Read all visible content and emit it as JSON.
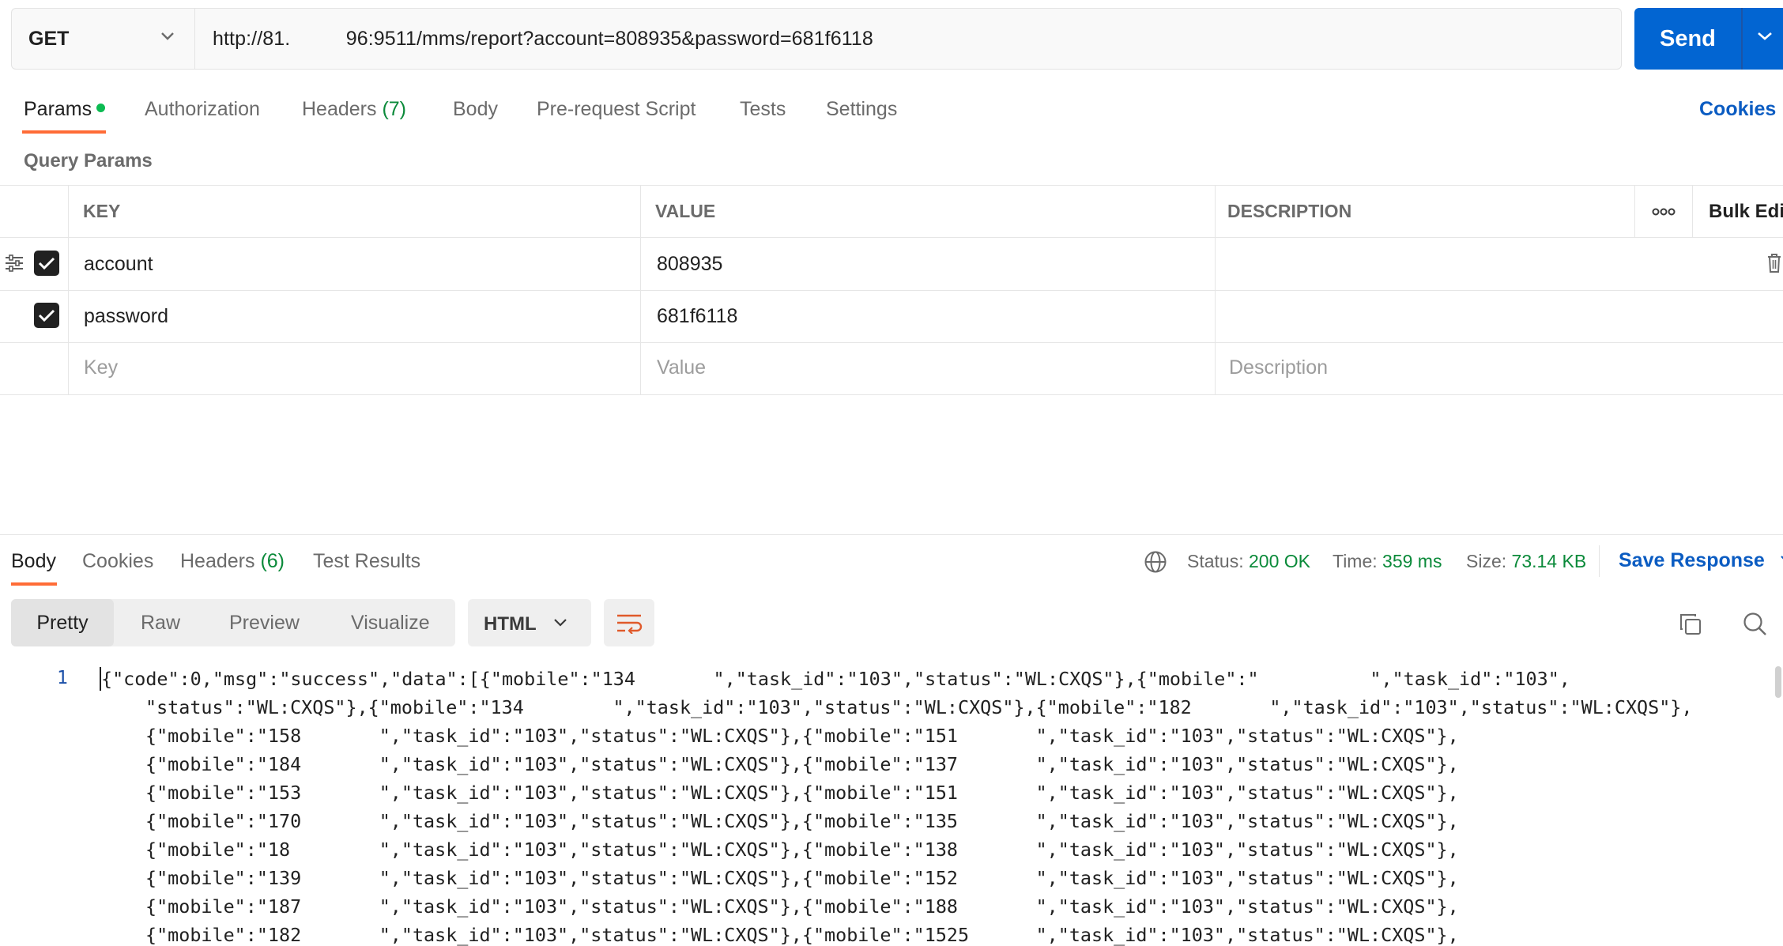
{
  "request": {
    "method": "GET",
    "url": "http://81.          96:9511/mms/report?account=808935&password=681f6118",
    "send_label": "Send"
  },
  "request_tabs": {
    "params": "Params",
    "authorization": "Authorization",
    "headers": "Headers",
    "headers_count": "(7)",
    "body": "Body",
    "pre_request": "Pre-request Script",
    "tests": "Tests",
    "settings": "Settings",
    "cookies": "Cookies"
  },
  "params": {
    "section_title": "Query Params",
    "columns": {
      "key": "KEY",
      "value": "VALUE",
      "description": "DESCRIPTION",
      "bulk_edit": "Bulk Edi"
    },
    "rows": [
      {
        "key": "account",
        "value": "808935",
        "checked": true
      },
      {
        "key": "password",
        "value": "681f6118",
        "checked": true
      }
    ],
    "empty_row": {
      "key": "Key",
      "value": "Value",
      "description": "Description"
    }
  },
  "response_tabs": {
    "body": "Body",
    "cookies": "Cookies",
    "headers": "Headers",
    "headers_count": "(6)",
    "test_results": "Test Results"
  },
  "response_meta": {
    "status_label": "Status:",
    "status_value": "200 OK",
    "time_label": "Time:",
    "time_value": "359 ms",
    "size_label": "Size:",
    "size_value": "73.14 KB",
    "save_response": "Save Response"
  },
  "view_modes": {
    "pretty": "Pretty",
    "raw": "Raw",
    "preview": "Preview",
    "visualize": "Visualize",
    "format": "HTML"
  },
  "body_lines": {
    "line_number": "1",
    "l1": "{\"code\":0,\"msg\":\"success\",\"data\":[{\"mobile\":\"134       \",\"task_id\":\"103\",\"status\":\"WL:CXQS\"},{\"mobile\":\"          \",\"task_id\":\"103\",",
    "l2": "\"status\":\"WL:CXQS\"},{\"mobile\":\"134        \",\"task_id\":\"103\",\"status\":\"WL:CXQS\"},{\"mobile\":\"182       \",\"task_id\":\"103\",\"status\":\"WL:CXQS\"},",
    "l3": "{\"mobile\":\"158       \",\"task_id\":\"103\",\"status\":\"WL:CXQS\"},{\"mobile\":\"151       \",\"task_id\":\"103\",\"status\":\"WL:CXQS\"},",
    "l4": "{\"mobile\":\"184       \",\"task_id\":\"103\",\"status\":\"WL:CXQS\"},{\"mobile\":\"137       \",\"task_id\":\"103\",\"status\":\"WL:CXQS\"},",
    "l5": "{\"mobile\":\"153       \",\"task_id\":\"103\",\"status\":\"WL:CXQS\"},{\"mobile\":\"151       \",\"task_id\":\"103\",\"status\":\"WL:CXQS\"},",
    "l6": "{\"mobile\":\"170       \",\"task_id\":\"103\",\"status\":\"WL:CXQS\"},{\"mobile\":\"135       \",\"task_id\":\"103\",\"status\":\"WL:CXQS\"},",
    "l7": "{\"mobile\":\"18        \",\"task_id\":\"103\",\"status\":\"WL:CXQS\"},{\"mobile\":\"138       \",\"task_id\":\"103\",\"status\":\"WL:CXQS\"},",
    "l8": "{\"mobile\":\"139       \",\"task_id\":\"103\",\"status\":\"WL:CXQS\"},{\"mobile\":\"152       \",\"task_id\":\"103\",\"status\":\"WL:CXQS\"},",
    "l9": "{\"mobile\":\"187       \",\"task_id\":\"103\",\"status\":\"WL:CXQS\"},{\"mobile\":\"188       \",\"task_id\":\"103\",\"status\":\"WL:CXQS\"},",
    "l10": "{\"mobile\":\"182       \",\"task_id\":\"103\",\"status\":\"WL:CXQS\"},{\"mobile\":\"1525      \",\"task_id\":\"103\",\"status\":\"WL:CXQS\"},"
  }
}
